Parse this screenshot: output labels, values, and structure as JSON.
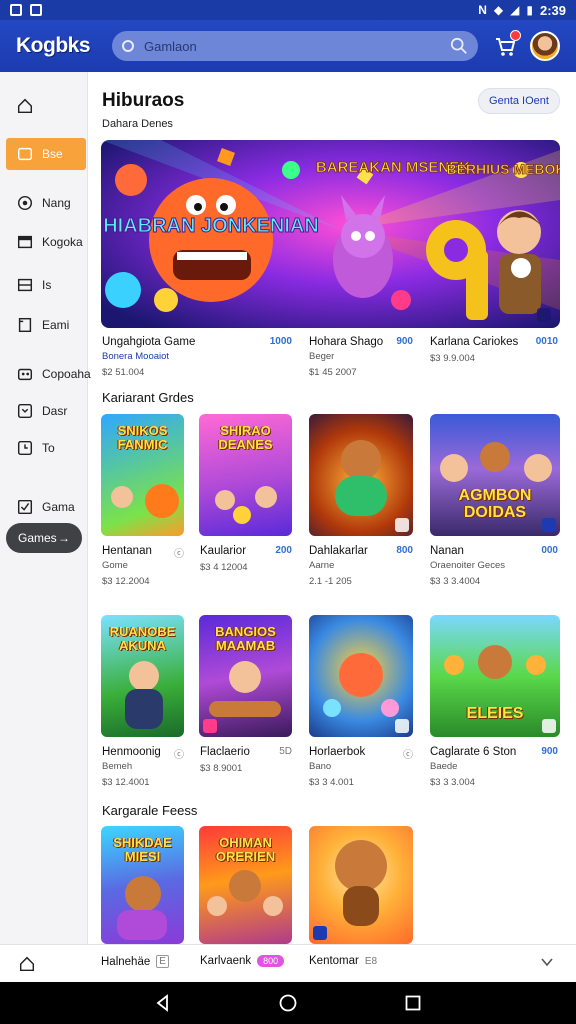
{
  "status_bar": {
    "time": "2:39",
    "nfc": "N"
  },
  "app_bar": {
    "logo": "Kogbks",
    "search_placeholder": "Gamlaon"
  },
  "sidebar": {
    "items": [
      {
        "label": "",
        "icon": "home-icon"
      },
      {
        "label": "Bse",
        "icon": "square-icon",
        "active": true
      },
      {
        "label": "Nang",
        "icon": "disc-icon"
      },
      {
        "label": "Kogoka",
        "icon": "card-icon"
      },
      {
        "label": "Is",
        "icon": "list-icon"
      },
      {
        "label": "Eami",
        "icon": "doc-icon"
      },
      {
        "label": "Copoaha",
        "icon": "gamepad-icon"
      },
      {
        "label": "Dasr",
        "icon": "clock-icon"
      },
      {
        "label": "To",
        "icon": "clock-icon"
      },
      {
        "label": "Gama",
        "icon": "checkbox-icon"
      }
    ],
    "pill": {
      "label": "Games",
      "arrow": "→"
    }
  },
  "main": {
    "title": "Hiburaos",
    "header_button": "Genta IOent",
    "subhead": "Dahara Denes",
    "banner": {
      "left_title": "HIABRAN JONKENIAN",
      "mid_title": "BAREAKAN MSENEK",
      "right_title": "BERHIUS MEBOK"
    },
    "featured": [
      {
        "name": "Ungahgiota Game",
        "price": "1000",
        "sub": "Bonera Mooaiot",
        "meta": "$2 51.004",
        "sub_blue": true
      },
      {
        "name": "Hohara Shago",
        "price": "900",
        "sub": "Beger",
        "meta": "$1 45 2007"
      },
      {
        "name": "Karlana Cariokes",
        "price": "0010",
        "sub": "",
        "meta": "$3 9.9.004"
      }
    ],
    "section1": "Kariarant Grdes",
    "row1": [
      {
        "thumb_title": "SNIKOS FANMIC",
        "name": "Hentanan",
        "price": "ⓒ",
        "sub": "Gome",
        "meta": "$3 12.2004",
        "price_style": "grey"
      },
      {
        "thumb_title": "SHIRAO DEANES",
        "name": "Kaularior",
        "price": "200",
        "sub": "",
        "meta": "$3 4 12004"
      },
      {
        "thumb_title": "",
        "name": "Dahlakarlar",
        "price": "800",
        "sub": "Aarne",
        "meta": "2.1 -1 205"
      },
      {
        "thumb_title": "AGMBON DOIDAS",
        "name": "Nanan",
        "price": "000",
        "sub": "Oraenoiter Geces",
        "meta": "$3 3 3.4004"
      }
    ],
    "row2": [
      {
        "thumb_title": "RUANOBE AKUNA",
        "name": "Henmoonig",
        "price": "ⓒ",
        "sub": "Bemeh",
        "meta": "$3 12.4001",
        "price_style": "grey"
      },
      {
        "thumb_title": "BANGIOS MAAMAB",
        "name": "Flaclaerio",
        "price": "5D",
        "sub": "",
        "meta": "$3 8.9001",
        "price_style": "grey"
      },
      {
        "thumb_title": "",
        "name": "Horlaerbok",
        "price": "ⓒ",
        "sub": "Bano",
        "meta": "$3 3 4.001",
        "price_style": "grey"
      },
      {
        "thumb_title": "ELEIES",
        "name": "Caglarate 6 Ston",
        "price": "900",
        "sub": "Baede",
        "meta": "$3 3 3.004"
      }
    ],
    "section2": "Kargarale Feess",
    "row3": [
      {
        "thumb_title": "SHIKDAE MIESI"
      },
      {
        "thumb_title": "OHIMAN ORERIEN"
      },
      {
        "thumb_title": ""
      }
    ]
  },
  "bottom_nav": {
    "items": [
      {
        "label": "",
        "icon": "home-icon"
      },
      {
        "label": "Halnehäe",
        "badge": "E"
      },
      {
        "label": "Karlvaenk",
        "badge": "800"
      },
      {
        "label": "Kentomar",
        "badge": "E8"
      }
    ]
  }
}
